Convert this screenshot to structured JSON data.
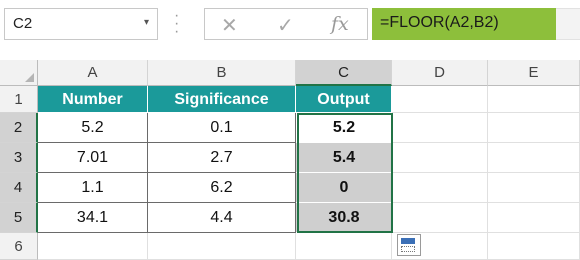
{
  "namebox": {
    "value": "C2",
    "arrow": "▾"
  },
  "formula_buttons": {
    "cancel": "✕",
    "enter": "✓",
    "fx": "fx"
  },
  "formula": "=FLOOR(A2,B2)",
  "columns": [
    "A",
    "B",
    "C",
    "D",
    "E"
  ],
  "rows": [
    "1",
    "2",
    "3",
    "4",
    "5",
    "6"
  ],
  "table": {
    "headers": [
      "Number",
      "Significance",
      "Output"
    ],
    "data": [
      [
        "5.2",
        "0.1",
        "5.2"
      ],
      [
        "7.01",
        "2.7",
        "5.4"
      ],
      [
        "1.1",
        "6.2",
        "0"
      ],
      [
        "34.1",
        "4.4",
        "30.8"
      ]
    ]
  },
  "colors": {
    "header_fill": "#1b9a9a",
    "formula_fill": "#8dbf3b",
    "selection": "#217346"
  },
  "icons": [
    "dropdown-arrow-icon",
    "cancel-icon",
    "enter-icon",
    "fx-icon",
    "quick-analysis-icon"
  ]
}
